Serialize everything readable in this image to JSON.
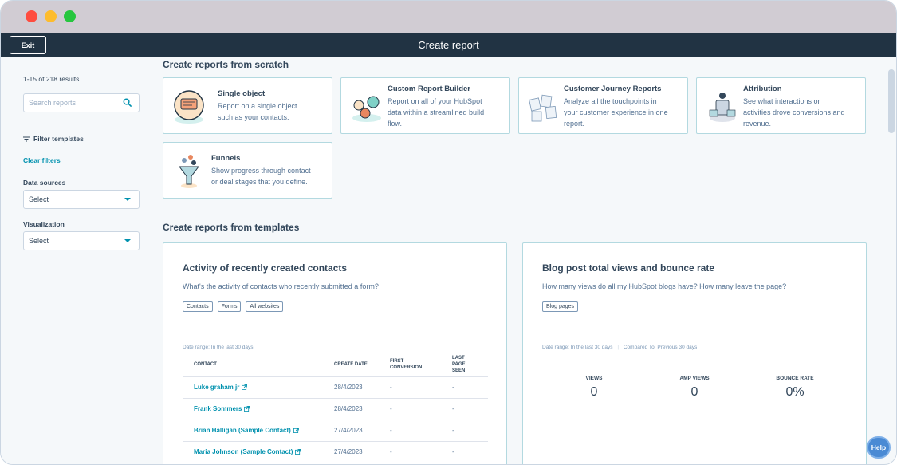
{
  "app": {
    "title": "Create report",
    "exit_label": "Exit"
  },
  "sidebar": {
    "results": "1-15 of 218 results",
    "search_placeholder": "Search reports",
    "filter_templates": "Filter templates",
    "clear_filters": "Clear filters",
    "data_sources_label": "Data sources",
    "data_sources_value": "Select",
    "visualization_label": "Visualization",
    "visualization_value": "Select"
  },
  "scratch": {
    "title": "Create reports from scratch",
    "cards": [
      {
        "title": "Single object",
        "desc1": "Report on a single object",
        "desc2": "such as your contacts.",
        "desc3": ""
      },
      {
        "title": "Custom Report Builder",
        "desc1": "Report on all of your HubSpot",
        "desc2": "data within a streamlined build",
        "desc3": "flow."
      },
      {
        "title": "Customer Journey Reports",
        "desc1": "Analyze all the touchpoints in",
        "desc2": "your customer experience in one",
        "desc3": "report."
      },
      {
        "title": "Attribution",
        "desc1": "See what interactions or",
        "desc2": "activities drove conversions and",
        "desc3": "revenue."
      },
      {
        "title": "Funnels",
        "desc1": "Show progress through contact",
        "desc2": "or deal stages that you define.",
        "desc3": ""
      }
    ]
  },
  "templates": {
    "title": "Create reports from templates",
    "activity": {
      "title": "Activity of recently created contacts",
      "desc": "What's the activity of contacts who recently submitted a form?",
      "tags": [
        "Contacts",
        "Forms",
        "All websites"
      ],
      "date_range": "Date range: In the last 30 days",
      "columns": [
        "CONTACT",
        "CREATE DATE",
        "FIRST CONVERSION",
        "LAST PAGE SEEN"
      ],
      "rows": [
        {
          "name": "Luke graham jr",
          "date": "28/4/2023",
          "first": "-",
          "last": "-"
        },
        {
          "name": "Frank Sommers",
          "date": "28/4/2023",
          "first": "-",
          "last": "-"
        },
        {
          "name": "Brian Halligan (Sample Contact)",
          "date": "27/4/2023",
          "first": "-",
          "last": "-"
        },
        {
          "name": "Maria Johnson (Sample Contact)",
          "date": "27/4/2023",
          "first": "-",
          "last": "-"
        }
      ]
    },
    "blog": {
      "title": "Blog post total views and bounce rate",
      "desc": "How many views do all my HubSpot blogs have? How many leave the page?",
      "tags": [
        "Blog pages"
      ],
      "date_range": "Date range: In the last 30 days",
      "compared": "Compared To: Previous 30 days",
      "metrics": [
        {
          "label": "VIEWS",
          "value": "0"
        },
        {
          "label": "AMP VIEWS",
          "value": "0"
        },
        {
          "label": "BOUNCE RATE",
          "value": "0%"
        }
      ]
    }
  },
  "help_label": "Help",
  "colors": {
    "header": "#213343",
    "accent": "#0091ae",
    "card_border": "#b3d9e0"
  }
}
